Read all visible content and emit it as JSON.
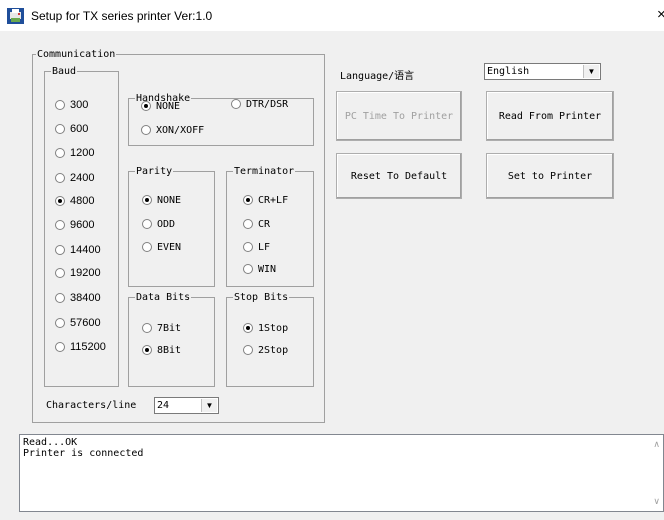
{
  "window": {
    "title": "Setup for TX series printer Ver:1.0",
    "icon": "printer-app-icon",
    "close_glyph": "×"
  },
  "communication": {
    "label": "Communication",
    "baud": {
      "label": "Baud",
      "options": [
        "300",
        "600",
        "1200",
        "2400",
        "4800",
        "9600",
        "14400",
        "19200",
        "38400",
        "57600",
        "115200"
      ],
      "selected": "4800"
    },
    "handshake": {
      "label": "Handshake",
      "options": [
        "NONE",
        "DTR/DSR",
        "XON/XOFF"
      ],
      "selected": "NONE"
    },
    "parity": {
      "label": "Parity",
      "options": [
        "NONE",
        "ODD",
        "EVEN"
      ],
      "selected": "NONE"
    },
    "terminator": {
      "label": "Terminator",
      "options": [
        "CR+LF",
        "CR",
        "LF",
        "WIN"
      ],
      "selected": "CR+LF"
    },
    "data_bits": {
      "label": "Data Bits",
      "options": [
        "7Bit",
        "8Bit"
      ],
      "selected": "8Bit"
    },
    "stop_bits": {
      "label": "Stop Bits",
      "options": [
        "1Stop",
        "2Stop"
      ],
      "selected": "1Stop"
    },
    "chars_per_line": {
      "label": "Characters/line",
      "value": "24"
    }
  },
  "language": {
    "label": "Language/语言",
    "value": "English"
  },
  "buttons": {
    "pc_time": "PC Time To Printer",
    "read": "Read From Printer",
    "reset": "Reset To Default",
    "set": "Set to Printer"
  },
  "log": {
    "lines": [
      "Read...OK",
      "Printer is connected"
    ]
  },
  "icons": {
    "dropdown": "chevron-down-icon",
    "scroll_up": "scroll-up-icon",
    "scroll_down": "scroll-down-icon"
  }
}
